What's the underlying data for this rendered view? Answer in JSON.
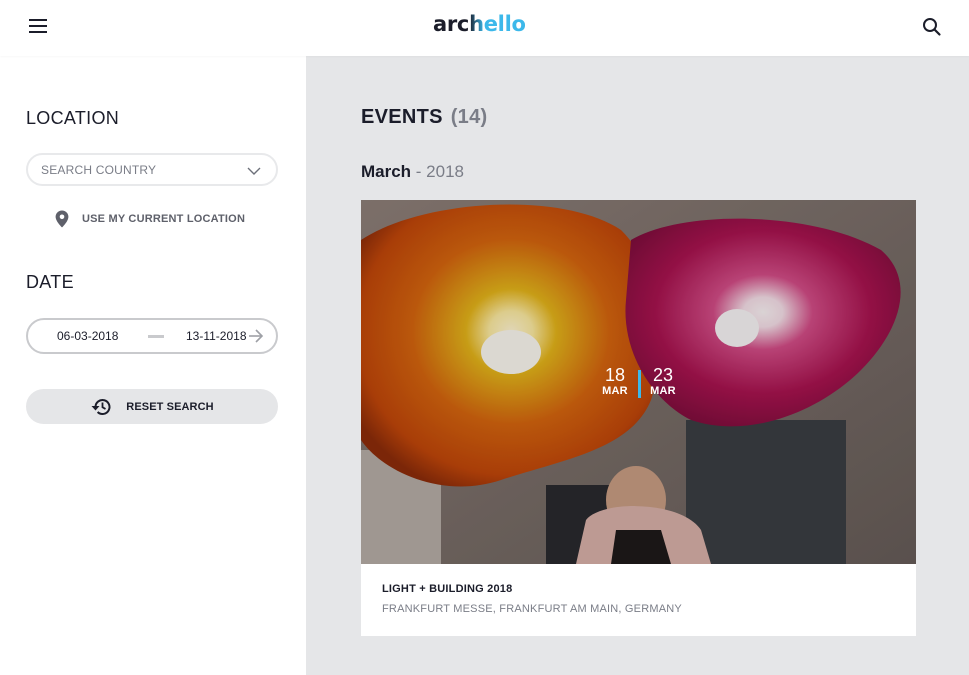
{
  "header": {
    "logo": {
      "part1": "arc",
      "part2": "h",
      "part3": "ello"
    },
    "menu_icon": "menu-icon",
    "search_icon": "search-icon"
  },
  "sidebar": {
    "location": {
      "title": "LOCATION",
      "country_placeholder": "SEARCH COUNTRY",
      "country_value": "",
      "use_location_label": "USE MY CURRENT LOCATION"
    },
    "date": {
      "title": "DATE",
      "start": "06-03-2018",
      "end": "13-11-2018"
    },
    "reset_label": "RESET SEARCH"
  },
  "main": {
    "events_title": "EVENTS",
    "events_count": "(14)",
    "month": "March",
    "year_sep": " - 2018",
    "events": [
      {
        "start_day": "18",
        "start_month": "MAR",
        "end_day": "23",
        "end_month": "MAR",
        "name": "LIGHT + BUILDING 2018",
        "place": "FRANKFURT MESSE, FRANKFURT AM MAIN, GERMANY"
      }
    ]
  },
  "colors": {
    "accent": "#3cb8ea",
    "text": "#1b1d2a",
    "muted": "#7a7d87",
    "background": "#e5e6e8"
  }
}
